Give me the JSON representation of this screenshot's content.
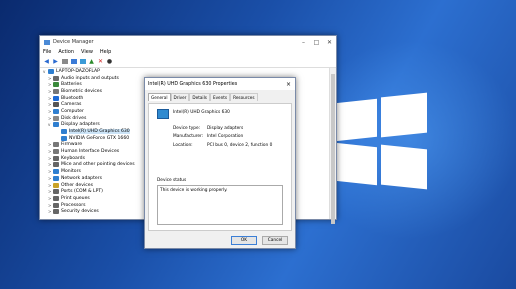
{
  "device_manager": {
    "title": "Device Manager",
    "menu": [
      "File",
      "Action",
      "View",
      "Help"
    ],
    "toolbar_icons": [
      "back-icon",
      "forward-icon",
      "properties-icon",
      "help-icon",
      "scan-icon",
      "update-driver-icon",
      "uninstall-icon",
      "disable-icon"
    ],
    "root": "LAPTOP-DAZOFLAP",
    "tree": [
      {
        "label": "Audio inputs and outputs",
        "level": 1,
        "exp": ">",
        "color": "#6a6a6a"
      },
      {
        "label": "Batteries",
        "level": 1,
        "exp": ">",
        "color": "#3a8a3a"
      },
      {
        "label": "Biometric devices",
        "level": 1,
        "exp": ">",
        "color": "#777"
      },
      {
        "label": "Bluetooth",
        "level": 1,
        "exp": ">",
        "color": "#1e6ad6"
      },
      {
        "label": "Cameras",
        "level": 1,
        "exp": ">",
        "color": "#555"
      },
      {
        "label": "Computer",
        "level": 1,
        "exp": ">",
        "color": "#2f7fd0"
      },
      {
        "label": "Disk drives",
        "level": 1,
        "exp": ">",
        "color": "#888"
      },
      {
        "label": "Display adapters",
        "level": 1,
        "exp": "v",
        "color": "#2f7fd0"
      },
      {
        "label": "Intel(R) UHD Graphics 630",
        "level": 2,
        "exp": "",
        "color": "#2f7fd0"
      },
      {
        "label": "NVIDIA GeForce GTX 1660",
        "level": 2,
        "exp": "",
        "color": "#2f7fd0"
      },
      {
        "label": "Firmware",
        "level": 1,
        "exp": ">",
        "color": "#777"
      },
      {
        "label": "Human Interface Devices",
        "level": 1,
        "exp": ">",
        "color": "#777"
      },
      {
        "label": "Keyboards",
        "level": 1,
        "exp": ">",
        "color": "#666"
      },
      {
        "label": "Mice and other pointing devices",
        "level": 1,
        "exp": ">",
        "color": "#666"
      },
      {
        "label": "Monitors",
        "level": 1,
        "exp": ">",
        "color": "#2f7fd0"
      },
      {
        "label": "Network adapters",
        "level": 1,
        "exp": ">",
        "color": "#2f7fd0"
      },
      {
        "label": "Other devices",
        "level": 1,
        "exp": ">",
        "color": "#c9a227"
      },
      {
        "label": "Ports (COM & LPT)",
        "level": 1,
        "exp": ">",
        "color": "#666"
      },
      {
        "label": "Print queues",
        "level": 1,
        "exp": ">",
        "color": "#666"
      },
      {
        "label": "Processors",
        "level": 1,
        "exp": ">",
        "color": "#666"
      },
      {
        "label": "Security devices",
        "level": 1,
        "exp": ">",
        "color": "#666"
      }
    ]
  },
  "properties": {
    "title": "Intel(R) UHD Graphics 630 Properties",
    "close": "×",
    "tabs": [
      "General",
      "Driver",
      "Details",
      "Events",
      "Resources"
    ],
    "device_name": "Intel(R) UHD Graphics 630",
    "device_type_label": "Device type:",
    "device_type": "Display adapters",
    "manufacturer_label": "Manufacturer:",
    "manufacturer": "Intel Corporation",
    "location_label": "Location:",
    "location": "PCI bus 0, device 2, function 0",
    "status_group": "Device status",
    "status_text": "This device is working properly.",
    "ok": "OK",
    "cancel": "Cancel"
  }
}
